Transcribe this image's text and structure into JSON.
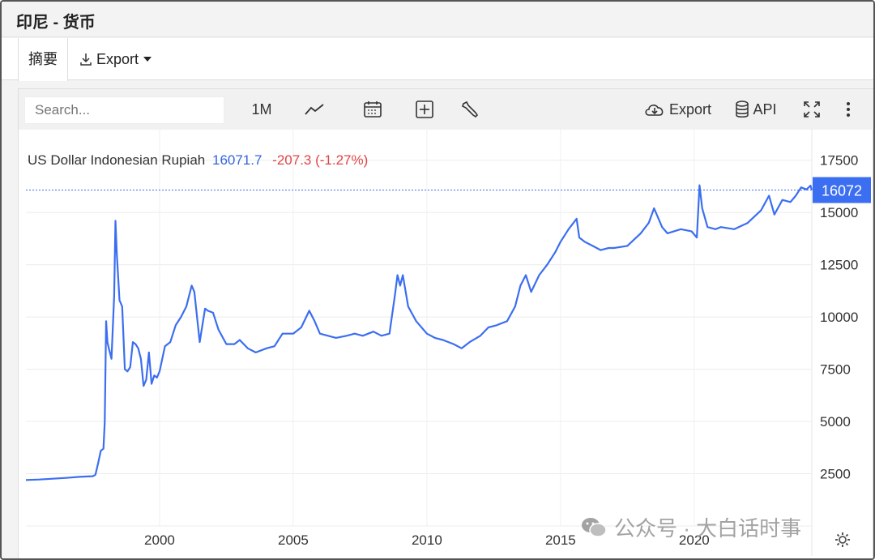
{
  "window": {
    "title": "印尼 - 货币"
  },
  "tabs": {
    "summary": "摘要",
    "export": "Export"
  },
  "toolbar": {
    "search_placeholder": "Search...",
    "range": "1M",
    "export": "Export",
    "api": "API"
  },
  "header": {
    "name": "US Dollar Indonesian Rupiah",
    "last": "16071.7",
    "change": "-207.3 (-1.27%)"
  },
  "colors": {
    "line": "#3b6ef0",
    "badge": "#3b6ef0",
    "change": "#e04444"
  },
  "watermark": "公众号 · 大白话时事",
  "chart_data": {
    "type": "line",
    "title": "",
    "xlabel": "",
    "ylabel": "",
    "last_value_label": "16072",
    "last_value": 16072,
    "xlim": [
      1995.0,
      2024.4
    ],
    "ylim": [
      0,
      19000
    ],
    "y_ticks": [
      2500,
      5000,
      7500,
      10000,
      12500,
      15000,
      17500
    ],
    "x_ticks": [
      2000,
      2005,
      2010,
      2015,
      2020
    ],
    "grid": true,
    "series": [
      {
        "name": "",
        "x": [
          1995.0,
          1995.5,
          1996.0,
          1996.5,
          1997.0,
          1997.5,
          1997.6,
          1997.7,
          1997.8,
          1997.9,
          1997.95,
          1998.0,
          1998.05,
          1998.1,
          1998.2,
          1998.3,
          1998.35,
          1998.4,
          1998.5,
          1998.6,
          1998.7,
          1998.8,
          1998.9,
          1999.0,
          1999.1,
          1999.2,
          1999.3,
          1999.4,
          1999.5,
          1999.6,
          1999.7,
          1999.8,
          1999.9,
          2000.0,
          2000.2,
          2000.4,
          2000.6,
          2000.8,
          2001.0,
          2001.2,
          2001.3,
          2001.4,
          2001.5,
          2001.7,
          2001.8,
          2002.0,
          2002.2,
          2002.5,
          2002.8,
          2003.0,
          2003.3,
          2003.6,
          2004.0,
          2004.3,
          2004.6,
          2005.0,
          2005.3,
          2005.6,
          2005.8,
          2006.0,
          2006.3,
          2006.6,
          2007.0,
          2007.3,
          2007.6,
          2008.0,
          2008.3,
          2008.6,
          2008.8,
          2008.9,
          2009.0,
          2009.1,
          2009.3,
          2009.6,
          2010.0,
          2010.3,
          2010.6,
          2011.0,
          2011.3,
          2011.6,
          2012.0,
          2012.3,
          2012.6,
          2013.0,
          2013.3,
          2013.5,
          2013.7,
          2013.9,
          2014.2,
          2014.5,
          2014.8,
          2015.0,
          2015.3,
          2015.6,
          2015.7,
          2015.9,
          2016.2,
          2016.5,
          2016.8,
          2017.0,
          2017.5,
          2018.0,
          2018.3,
          2018.5,
          2018.8,
          2019.0,
          2019.5,
          2019.9,
          2020.1,
          2020.2,
          2020.3,
          2020.5,
          2020.8,
          2021.0,
          2021.5,
          2022.0,
          2022.5,
          2022.8,
          2023.0,
          2023.3,
          2023.6,
          2023.8,
          2024.0,
          2024.2,
          2024.35,
          2024.4
        ],
        "y": [
          2200,
          2220,
          2260,
          2300,
          2350,
          2380,
          2450,
          3000,
          3600,
          3700,
          5000,
          9800,
          8800,
          8500,
          8000,
          11000,
          14600,
          13000,
          10800,
          10500,
          7500,
          7400,
          7600,
          8800,
          8700,
          8500,
          8000,
          6700,
          7000,
          8300,
          6800,
          7200,
          7100,
          7400,
          8600,
          8800,
          9600,
          10000,
          10500,
          11500,
          11200,
          10000,
          8800,
          10400,
          10300,
          10200,
          9400,
          8700,
          8700,
          8900,
          8500,
          8300,
          8500,
          8600,
          9200,
          9200,
          9500,
          10300,
          9800,
          9200,
          9100,
          9000,
          9100,
          9200,
          9100,
          9300,
          9100,
          9200,
          11000,
          12000,
          11500,
          12000,
          10500,
          9800,
          9200,
          9000,
          8900,
          8700,
          8500,
          8800,
          9100,
          9500,
          9600,
          9800,
          10500,
          11500,
          12000,
          11200,
          12000,
          12500,
          13100,
          13600,
          14200,
          14700,
          13800,
          13600,
          13400,
          13200,
          13300,
          13300,
          13400,
          14000,
          14500,
          15200,
          14300,
          14000,
          14200,
          14100,
          13800,
          16300,
          15200,
          14300,
          14200,
          14300,
          14200,
          14500,
          15100,
          15800,
          14900,
          15600,
          15500,
          15800,
          16200,
          16100,
          16280,
          16072
        ]
      }
    ]
  }
}
